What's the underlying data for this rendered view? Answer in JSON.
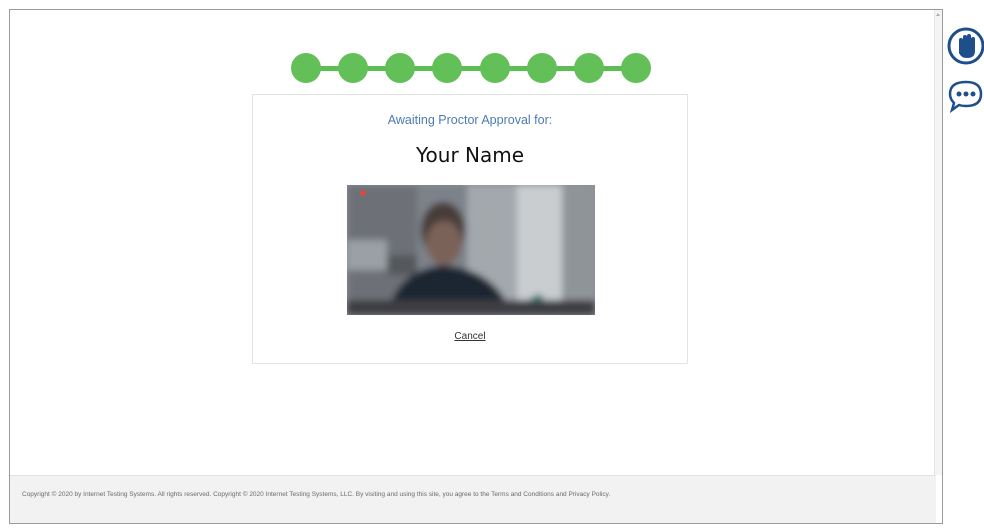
{
  "progress": {
    "total_steps": 8,
    "completed_steps": 8,
    "color": "#63c058"
  },
  "card": {
    "awaiting_label": "Awaiting Proctor Approval for:",
    "candidate_name": "Your Name",
    "cancel_label": "Cancel"
  },
  "footer": {
    "copyright": "Copyright © 2020 by Internet Testing Systems. All rights reserved. Copyright © 2020 Internet Testing Systems, LLC. By visiting and using this site, you agree to the Terms and Conditions and Privacy Policy."
  },
  "side_icons": [
    {
      "icon": "raise-hand-icon",
      "color": "#1e4f8a"
    },
    {
      "icon": "chat-bubble-icon",
      "color": "#1e4f8a"
    }
  ],
  "colors": {
    "accent_blue": "#4d7ab5",
    "progress_green": "#63c058"
  }
}
